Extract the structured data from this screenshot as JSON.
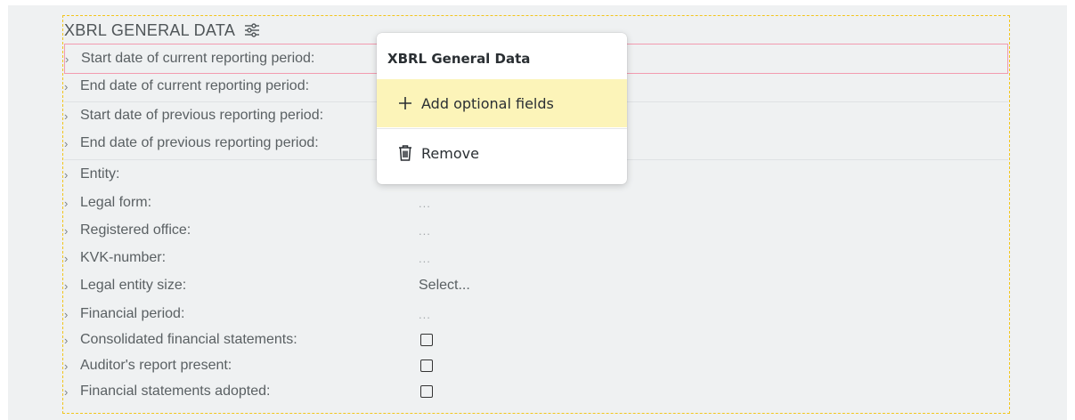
{
  "section": {
    "title": "XBRL GENERAL DATA",
    "settings_icon": "sliders-icon"
  },
  "rows": [
    {
      "label": "Start date of current reporting period:",
      "value": ""
    },
    {
      "label": "End date of current reporting period:",
      "value": ""
    },
    {
      "label": "Start date of previous reporting period:",
      "value": ""
    },
    {
      "label": "End date of previous reporting period:",
      "value": ""
    },
    {
      "label": "Entity:",
      "value": ""
    },
    {
      "label": "Legal form:",
      "value": "..."
    },
    {
      "label": "Registered office:",
      "value": "..."
    },
    {
      "label": "KVK-number:",
      "value": "..."
    },
    {
      "label": "Legal entity size:",
      "value": "Select..."
    },
    {
      "label": "Financial period:",
      "value": "..."
    },
    {
      "label": "Consolidated financial statements:",
      "value": ""
    },
    {
      "label": "Auditor's report present:",
      "value": ""
    },
    {
      "label": "Financial statements adopted:",
      "value": ""
    }
  ],
  "popup": {
    "title": "XBRL General Data",
    "items": [
      {
        "label": "Add optional fields",
        "icon": "plus-icon"
      },
      {
        "label": "Remove",
        "icon": "trash-icon"
      }
    ]
  },
  "colors": {
    "canvas_bg": "#eff1f2",
    "section_border": "#f2c51c",
    "highlight_border": "#f29bb0",
    "popup_active_bg": "#fcf4b9"
  }
}
